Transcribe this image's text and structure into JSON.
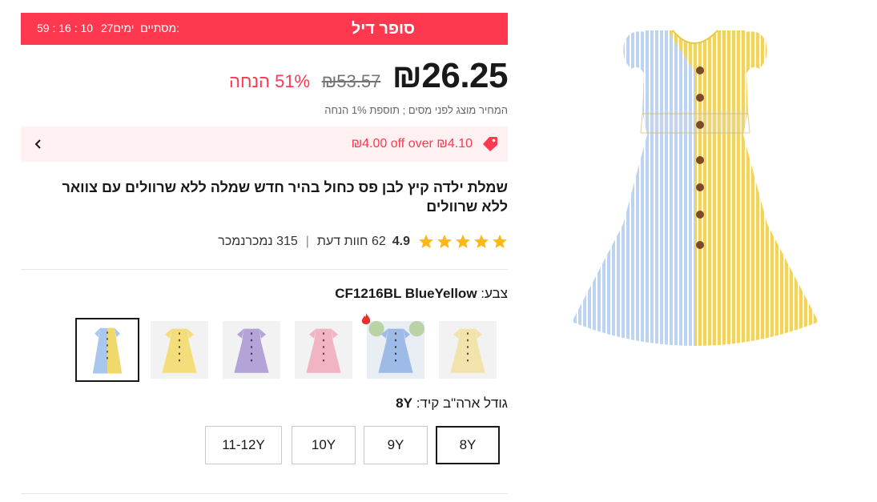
{
  "deal": {
    "title": "סופר דיל",
    "ends_label": "מסתיים:",
    "days": "27",
    "days_label": "ימים",
    "timer": "59 : 16 : 10",
    "accent_color": "#fd384f"
  },
  "price": {
    "current": "26.25",
    "currency": "₪",
    "original": "₪53.57",
    "discount": "51% הנחה",
    "tax_note": "המחיר מוצג לפני מסים ; תוספת 1% הנחה"
  },
  "coupon": {
    "text": "₪4.00 off over ₪4.10",
    "icon": "tag-icon"
  },
  "product": {
    "title": "שמלת ילדה קיץ לבן פס כחול בהיר חדש שמלה ללא שרוולים עם צוואר ללא שרוולים",
    "rating": "4.9",
    "reviews": "62 חוות דעת",
    "sold": "315 נמכרנמכר",
    "stars": 5
  },
  "color": {
    "label": "צבע:",
    "selected": "CF1216BL BlueYellow",
    "options": [
      "BlueYellow",
      "Yellow",
      "Purple",
      "Pink",
      "Blue",
      "Beige"
    ]
  },
  "size": {
    "label": "גודל ארה\"ב קיד:",
    "selected": "8Y",
    "options": [
      "8Y",
      "9Y",
      "10Y",
      "11-12Y"
    ]
  }
}
